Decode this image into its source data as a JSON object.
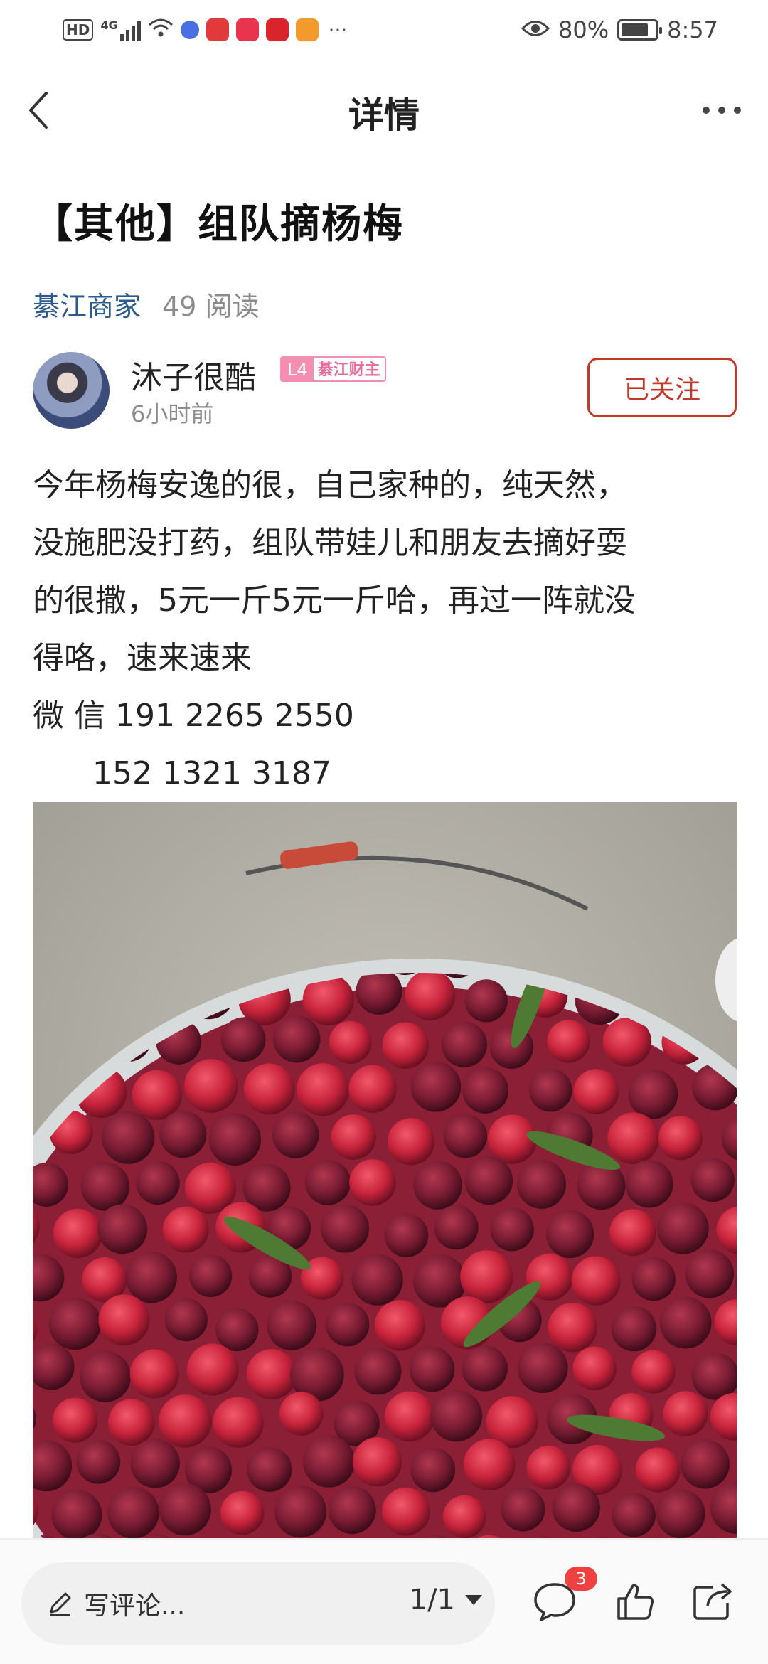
{
  "status_bar": {
    "hd": "HD",
    "network": "4G",
    "more": "···",
    "battery_percent": "80%",
    "battery_level": 0.8,
    "time": "8:57"
  },
  "header": {
    "title": "详情"
  },
  "post": {
    "title": "【其他】组队摘杨梅",
    "category": "綦江商家",
    "reads": "49 阅读",
    "author": {
      "name": "沐子很酷",
      "level": "L4",
      "level_title": "綦江财主",
      "time": "6小时前",
      "follow_label": "已关注"
    },
    "content_lines": [
      "今年杨梅安逸的很，自己家种的，纯天然，",
      "没施肥没打药，组队带娃儿和朋友去摘好耍",
      "的很撒，5元一斤5元一斤哈，再过一阵就没",
      "得咯，速来速来",
      "微 信  191 2265 2550",
      "152 1321 3187"
    ]
  },
  "bottom_bar": {
    "comment_placeholder": "写评论...",
    "pager": "1/1",
    "comment_count": "3"
  },
  "colors": {
    "category": "#2b5a8c",
    "follow": "#c0392b",
    "badge": "#f04141",
    "level": "#f48fb1"
  }
}
